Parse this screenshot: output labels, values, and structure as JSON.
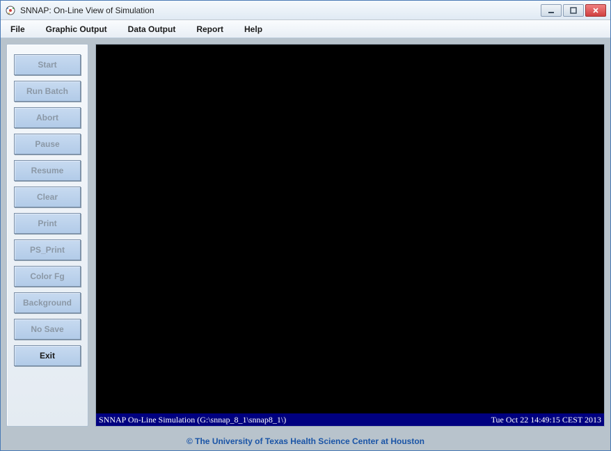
{
  "window": {
    "title": "SNNAP:  On-Line View of Simulation"
  },
  "menu": {
    "file": "File",
    "graphic_output": "Graphic Output",
    "data_output": "Data Output",
    "report": "Report",
    "help": "Help"
  },
  "sidebar": {
    "start": "Start",
    "run_batch": "Run Batch",
    "abort": "Abort",
    "pause": "Pause",
    "resume": "Resume",
    "clear": "Clear",
    "print": "Print",
    "ps_print": "PS_Print",
    "color_fg": "Color Fg",
    "background": "Background",
    "no_save": "No Save",
    "exit": "Exit"
  },
  "status": {
    "left": "SNNAP On-Line Simulation (G:\\snnap_8_1\\snnap8_1\\)",
    "right": "Tue Oct 22 14:49:15 CEST 2013"
  },
  "footer": {
    "text": "© The University of Texas Health Science Center at Houston"
  },
  "icons": {
    "minimize": "minimize",
    "maximize": "maximize",
    "close": "close"
  }
}
